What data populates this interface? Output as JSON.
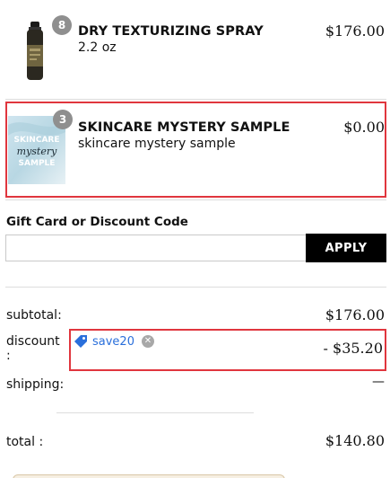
{
  "cart": {
    "items": [
      {
        "quantity": "8",
        "name": "DRY TEXTURIZING SPRAY",
        "variant": "2.2 oz",
        "price": "$176.00",
        "image_icon": "spray-can-product-image"
      },
      {
        "quantity": "3",
        "name": "SKINCARE MYSTERY SAMPLE",
        "variant": "skincare mystery sample",
        "price": "$0.00",
        "image_icon": "mystery-sample-product-image",
        "image_text": [
          "SKINCARE",
          "mystery",
          "SAMPLE"
        ]
      }
    ]
  },
  "discount_form": {
    "label": "Gift Card or Discount Code",
    "input_value": "",
    "apply_label": "APPLY"
  },
  "summary": {
    "subtotal_label": "subtotal:",
    "subtotal_value": "$176.00",
    "discount_label_line1": "discount",
    "discount_label_line2": ":",
    "discount_code": "save20",
    "discount_icon": "tag-icon",
    "remove_icon": "close-icon",
    "discount_value": "- $35.20",
    "shipping_label": "shipping:",
    "shipping_value": "—",
    "total_label": "total :",
    "total_value": "$140.80"
  },
  "colors": {
    "highlight_border": "#e0363e",
    "apply_button": "#000000",
    "discount_code_text": "#2a6fdb",
    "badge": "#8f8f8f"
  }
}
